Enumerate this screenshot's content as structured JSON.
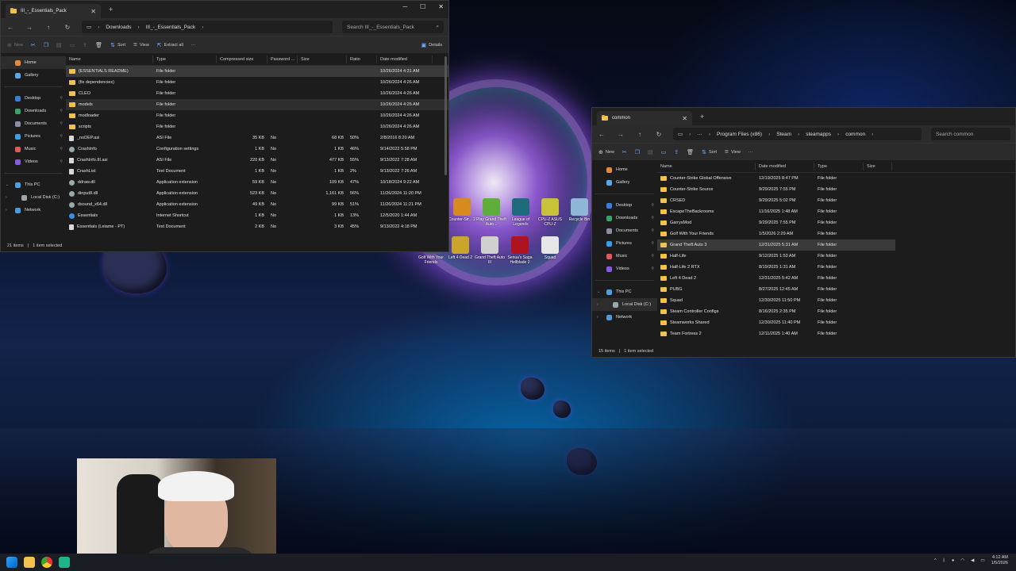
{
  "left_window": {
    "tab_title": "III_-_Essentials_Pack",
    "breadcrumbs": [
      "Downloads",
      "III_-_Essentials_Pack"
    ],
    "search_placeholder": "Search III_-_Essentials_Pack",
    "toolbar": {
      "new": "New",
      "sort": "Sort",
      "view": "View",
      "extract": "Extract all",
      "more": "···",
      "details": "Details"
    },
    "nav": [
      {
        "label": "Home",
        "icon": "home-icon",
        "selected": true
      },
      {
        "label": "Gallery",
        "icon": "gallery-icon"
      },
      {
        "label": "Desktop",
        "icon": "desktop-icon",
        "pinned": true
      },
      {
        "label": "Downloads",
        "icon": "downloads-icon",
        "pinned": true
      },
      {
        "label": "Documents",
        "icon": "documents-icon",
        "pinned": true
      },
      {
        "label": "Pictures",
        "icon": "pictures-icon",
        "pinned": true
      },
      {
        "label": "Music",
        "icon": "music-icon",
        "pinned": true
      },
      {
        "label": "Videos",
        "icon": "videos-icon",
        "pinned": true
      },
      {
        "label": "This PC",
        "icon": "this-pc-icon"
      },
      {
        "label": "Local Disk (C:)",
        "icon": "disk-icon"
      },
      {
        "label": "Network",
        "icon": "network-icon"
      }
    ],
    "columns": [
      "Name",
      "Type",
      "Compressed size",
      "Password ...",
      "Size",
      "Ratio",
      "Date modified"
    ],
    "rows": [
      [
        "(ESSENTIALS README)",
        "File folder",
        "",
        "",
        "",
        "",
        "10/26/2024 4:31 AM"
      ],
      [
        "(fix dependencies)",
        "File folder",
        "",
        "",
        "",
        "",
        "10/26/2024 4:26 AM"
      ],
      [
        "CLEO",
        "File folder",
        "",
        "",
        "",
        "",
        "10/26/2024 4:26 AM"
      ],
      [
        "models",
        "File folder",
        "",
        "",
        "",
        "",
        "10/26/2024 4:26 AM"
      ],
      [
        "modloader",
        "File folder",
        "",
        "",
        "",
        "",
        "10/26/2024 4:26 AM"
      ],
      [
        "scripts",
        "File folder",
        "",
        "",
        "",
        "",
        "10/26/2024 4:26 AM"
      ],
      [
        "_noDEP.asi",
        "ASI File",
        "35 KB",
        "No",
        "68 KB",
        "50%",
        "2/8/2016 8:20 AM"
      ],
      [
        "CrashInfo",
        "Configuration settings",
        "1 KB",
        "No",
        "1 KB",
        "46%",
        "9/14/2022 5:58 PM"
      ],
      [
        "CrashInfo.III.asi",
        "ASI File",
        "220 KB",
        "No",
        "477 KB",
        "55%",
        "9/13/2022 7:28 AM"
      ],
      [
        "CrashList",
        "Text Document",
        "1 KB",
        "No",
        "1 KB",
        "2%",
        "9/13/2022 7:26 AM"
      ],
      [
        "ddraw.dll",
        "Application extension",
        "59 KB",
        "No",
        "109 KB",
        "47%",
        "10/18/2024 9:22 AM"
      ],
      [
        "dinput8.dll",
        "Application extension",
        "523 KB",
        "No",
        "1,161 KB",
        "56%",
        "11/26/2024 11:20 PM"
      ],
      [
        "dsound_x64.dll",
        "Application extension",
        "49 KB",
        "No",
        "99 KB",
        "51%",
        "11/26/2024 11:21 PM"
      ],
      [
        "Essentials",
        "Internet Shortcut",
        "1 KB",
        "No",
        "1 KB",
        "13%",
        "12/5/2020 1:44 AM"
      ],
      [
        "Essentials (Leiame - PT)",
        "Text Document",
        "2 KB",
        "No",
        "3 KB",
        "45%",
        "9/13/2022 4:18 PM"
      ]
    ],
    "status": {
      "items": "21 items",
      "selected": "1 item selected"
    }
  },
  "right_window": {
    "tab_title": "common",
    "breadcrumbs": [
      "Program Files (x86)",
      "Steam",
      "steamapps",
      "common"
    ],
    "search_placeholder": "Search common",
    "toolbar": {
      "new": "New",
      "sort": "Sort",
      "view": "View",
      "more": "···"
    },
    "nav": [
      {
        "label": "Home",
        "icon": "home-icon"
      },
      {
        "label": "Gallery",
        "icon": "gallery-icon"
      },
      {
        "label": "Desktop",
        "icon": "desktop-icon",
        "pinned": true
      },
      {
        "label": "Downloads",
        "icon": "downloads-icon",
        "pinned": true
      },
      {
        "label": "Documents",
        "icon": "documents-icon",
        "pinned": true
      },
      {
        "label": "Pictures",
        "icon": "pictures-icon",
        "pinned": true
      },
      {
        "label": "Music",
        "icon": "music-icon",
        "pinned": true
      },
      {
        "label": "Videos",
        "icon": "videos-icon",
        "pinned": true
      },
      {
        "label": "This PC",
        "icon": "this-pc-icon"
      },
      {
        "label": "Local Disk (C:)",
        "icon": "disk-icon",
        "selected": true
      },
      {
        "label": "Network",
        "icon": "network-icon"
      }
    ],
    "columns": [
      "Name",
      "Date modified",
      "Type",
      "Size"
    ],
    "rows": [
      [
        "Counter-Strike Global Offensive",
        "12/19/2025 8:47 PM",
        "File folder"
      ],
      [
        "Counter-Strike Source",
        "9/29/2025 7:55 PM",
        "File folder"
      ],
      [
        "CRSED",
        "9/29/2025 5:02 PM",
        "File folder"
      ],
      [
        "EscapeTheBackrooms",
        "11/16/2025 1:48 AM",
        "File folder"
      ],
      [
        "GarrysMod",
        "9/29/2025 7:55 PM",
        "File folder"
      ],
      [
        "Golf With Your Friends",
        "1/5/2026 2:29 AM",
        "File folder"
      ],
      [
        "Grand Theft Auto 3",
        "12/31/2025 5:31 AM",
        "File folder"
      ],
      [
        "Half-Life",
        "9/12/2025 1:53 AM",
        "File folder"
      ],
      [
        "Half-Life 2 RTX",
        "8/19/2025 1:31 AM",
        "File folder"
      ],
      [
        "Left 4 Dead 2",
        "12/31/2025 5:42 AM",
        "File folder"
      ],
      [
        "PUBG",
        "8/27/2025 12:45 AM",
        "File folder"
      ],
      [
        "Squad",
        "12/30/2025 11:50 PM",
        "File folder"
      ],
      [
        "Steam Controller Configs",
        "8/16/2025 2:35 PM",
        "File folder"
      ],
      [
        "Steamworks Shared",
        "12/30/2025 11:40 PM",
        "File folder"
      ],
      [
        "Team Fortress 2",
        "12/11/2025 1:40 AM",
        "File folder"
      ]
    ],
    "status": {
      "items": "15 items",
      "selected": "1 item selected"
    }
  },
  "desktop_icons": [
    {
      "label": "Counter-Str... 2",
      "color": "#d98a1f"
    },
    {
      "label": "Play Grand Theft Auto...",
      "color": "#5fae3b"
    },
    {
      "label": "League of Legends",
      "color": "#1c6b7a"
    },
    {
      "label": "CPU-Z ASUS CPU-Z",
      "color": "#c8c23a"
    },
    {
      "label": "Recycle Bin",
      "color": "#8fb6d6"
    },
    {
      "label": "Golf With Your Friends",
      "color": "#4a5a6a"
    },
    {
      "label": "Left 4 Dead 2",
      "color": "#c9a52a"
    },
    {
      "label": "Grand Theft Auto III",
      "color": "#d0d0d0"
    },
    {
      "label": "Senua's Saga Hellblade 2",
      "color": "#b0121e"
    },
    {
      "label": "Squad",
      "color": "#e6e6e6"
    }
  ],
  "taskbar": {
    "time": "4:12 AM",
    "date": "1/5/2026"
  }
}
